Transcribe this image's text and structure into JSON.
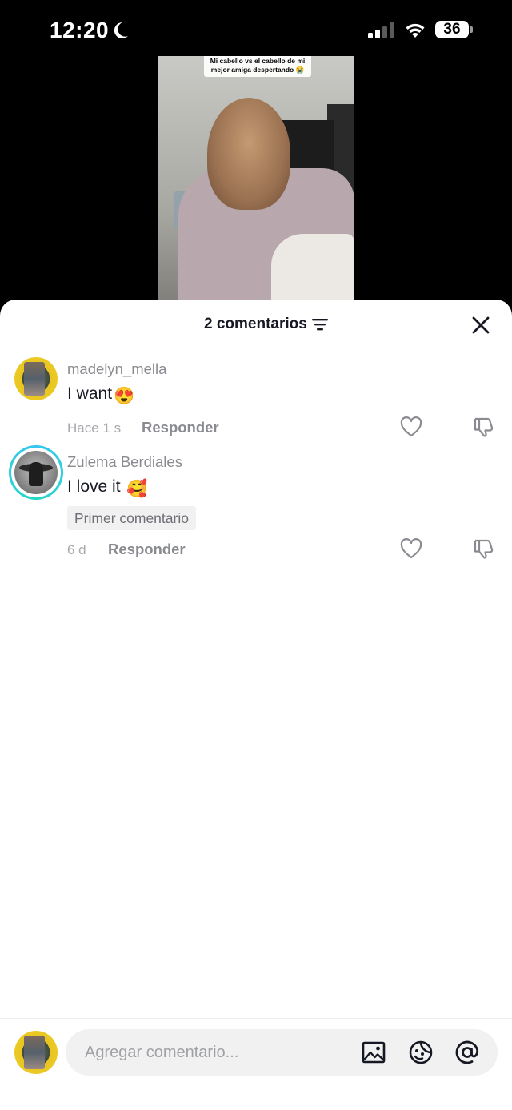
{
  "status_bar": {
    "time": "12:20",
    "battery": "36"
  },
  "video": {
    "caption": "Mi cabello vs el cabello de mi mejor amiga despertando 😭"
  },
  "comments_panel": {
    "count_label": "2 comentarios"
  },
  "comments": [
    {
      "username": "madelyn_mella",
      "text": "I want",
      "emoji": "😍",
      "time": "Hace 1 s",
      "reply_label": "Responder"
    },
    {
      "username": "Zulema Berdiales",
      "text": "I love it",
      "emoji": "🥰",
      "badge": "Primer comentario",
      "time": "6 d",
      "reply_label": "Responder"
    }
  ],
  "composer": {
    "placeholder": "Agregar comentario..."
  },
  "icons": {
    "moon": "moon-icon",
    "signal": "signal-icon",
    "wifi": "wifi-icon",
    "filter": "filter-icon",
    "close": "close-icon",
    "like": "heart-icon",
    "dislike": "thumbs-down-icon",
    "image": "image-icon",
    "emoji": "emoji-icon",
    "mention": "at-icon"
  },
  "colors": {
    "accent_ring": "#37c6ef",
    "text_primary": "#161823",
    "text_secondary": "#8a8b91"
  }
}
